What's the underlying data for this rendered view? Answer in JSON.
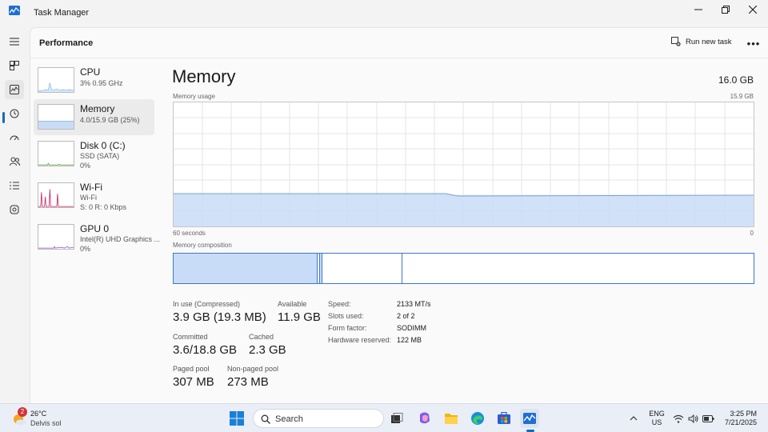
{
  "window": {
    "title": "Task Manager",
    "minimize_icon": "minimize-icon",
    "restore_icon": "restore-icon",
    "close_icon": "close-icon"
  },
  "nav": {
    "items": [
      {
        "name": "menu",
        "icon": "hamburger-icon"
      },
      {
        "name": "processes",
        "icon": "processes-icon"
      },
      {
        "name": "performance",
        "icon": "performance-icon",
        "active": true
      },
      {
        "name": "app-history",
        "icon": "history-icon"
      },
      {
        "name": "startup-apps",
        "icon": "startup-icon"
      },
      {
        "name": "users",
        "icon": "users-icon"
      },
      {
        "name": "details",
        "icon": "details-icon"
      },
      {
        "name": "services",
        "icon": "services-icon"
      }
    ],
    "settings_icon": "gear-icon"
  },
  "header": {
    "title": "Performance",
    "run_new_task": "Run new task",
    "more": "•••"
  },
  "devices": [
    {
      "name": "CPU",
      "line1": "3%  0.95 GHz",
      "line2": ""
    },
    {
      "name": "Memory",
      "line1": "4.0/15.9 GB (25%)",
      "line2": "",
      "selected": true
    },
    {
      "name": "Disk 0 (C:)",
      "line1": "SSD (SATA)",
      "line2": "0%"
    },
    {
      "name": "Wi-Fi",
      "line1": "Wi-Fi",
      "line2": "S: 0  R: 0 Kbps"
    },
    {
      "name": "GPU 0",
      "line1": "Intel(R) UHD Graphics ...",
      "line2": "0%"
    }
  ],
  "memory": {
    "title": "Memory",
    "total": "16.0 GB",
    "usage_label": "Memory usage",
    "usage_max": "15.9 GB",
    "time_left": "60 seconds",
    "time_right": "0",
    "composition_label": "Memory composition",
    "composition": {
      "in_use_fraction": 0.25,
      "modified_fraction": 0.01,
      "standby_fraction": 0.14
    },
    "stats": {
      "in_use_label": "In use (Compressed)",
      "in_use_value": "3.9 GB (19.3 MB)",
      "available_label": "Available",
      "available_value": "11.9 GB",
      "committed_label": "Committed",
      "committed_value": "3.6/18.8 GB",
      "cached_label": "Cached",
      "cached_value": "2.3 GB",
      "paged_label": "Paged pool",
      "paged_value": "307 MB",
      "nonpaged_label": "Non-paged pool",
      "nonpaged_value": "273 MB"
    },
    "details": [
      {
        "label": "Speed:",
        "value": "2133 MT/s"
      },
      {
        "label": "Slots used:",
        "value": "2 of 2"
      },
      {
        "label": "Form factor:",
        "value": "SODIMM"
      },
      {
        "label": "Hardware reserved:",
        "value": "122 MB"
      }
    ]
  },
  "taskbar": {
    "weather_temp": "26°C",
    "weather_desc": "Delvis sol",
    "weather_badge": "2",
    "search_placeholder": "Search",
    "lang_line1": "ENG",
    "lang_line2": "US",
    "time": "3:25 PM",
    "date": "7/21/2025",
    "icons": [
      "windows-start-icon",
      "search-icon",
      "task-view-icon",
      "copilot-icon",
      "file-explorer-icon",
      "edge-icon",
      "store-icon",
      "task-manager-icon",
      "chevron-up-icon",
      "wifi-icon",
      "volume-icon",
      "battery-icon"
    ]
  },
  "colors": {
    "accent": "#0f6cbd",
    "memory_fill": "#c9dcf7",
    "memory_line": "#7aa3d9",
    "composition_border": "#3d79c7",
    "wifi_spike": "#c2185b"
  }
}
